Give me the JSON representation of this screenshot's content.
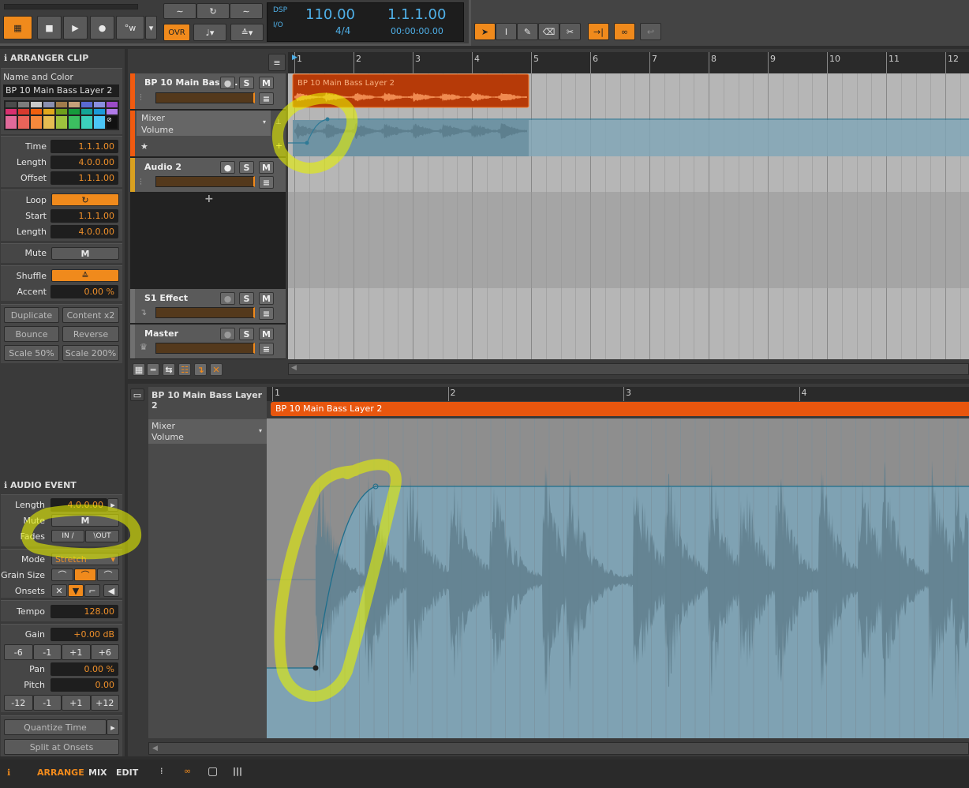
{
  "transport": {
    "ovr": "OVR",
    "dsp": "DSP",
    "io": "I/O",
    "tempo": "110.00",
    "signature": "4/4",
    "position": "1.1.1.00",
    "time": "00:00:00.00",
    "accent": "#f08a1c",
    "display_color": "#4fb0e8"
  },
  "inspector": {
    "clip_title": "ARRANGER CLIP",
    "name_color_label": "Name and Color",
    "clip_name": "BP 10 Main Bass Layer 2",
    "palette": [
      "#4b4b4b",
      "#7d7d7d",
      "#c9c9c9",
      "#8a8fb0",
      "#a17c4c",
      "#c6a07a",
      "#5a6ad1",
      "#8a8fe0",
      "#9b4bc7",
      "#d8306f",
      "#d63a2e",
      "#f0600e",
      "#e0a81c",
      "#6e9f1c",
      "#169a3c",
      "#13a596",
      "#1a9ad8",
      "#b07ae8",
      "#e06a9a",
      "#e8645a",
      "#f6893c",
      "#e6bd52",
      "#9ec23e",
      "#3cbf60",
      "#3ccfbb",
      "#4cc6f6"
    ],
    "time_label": "Time",
    "time": "1.1.1.00",
    "length_label": "Length",
    "length": "4.0.0.00",
    "offset_label": "Offset",
    "offset": "1.1.1.00",
    "loop_label": "Loop",
    "start_label": "Start",
    "start": "1.1.1.00",
    "loop_length_label": "Length",
    "loop_length": "4.0.0.00",
    "mute_label": "Mute",
    "mute": "M",
    "shuffle_label": "Shuffle",
    "accent_label": "Accent",
    "accent": "0.00 %",
    "actions": [
      "Duplicate",
      "Content x2",
      "Bounce",
      "Reverse",
      "Scale 50%",
      "Scale 200%"
    ],
    "event_title": "AUDIO EVENT",
    "ev_length_label": "Length",
    "ev_length": "4.0.0.00",
    "ev_mute_label": "Mute",
    "ev_mute": "M",
    "fades_label": "Fades",
    "fade_in": "IN",
    "fade_out": "OUT",
    "mode_label": "Mode",
    "mode": "Stretch",
    "grain_label": "Grain Size",
    "onsets_label": "Onsets",
    "tempo_label": "Tempo",
    "tempo": "128.00",
    "gain_label": "Gain",
    "gain": "+0.00 dB",
    "gain_steps": [
      "-6",
      "-1",
      "+1",
      "+6"
    ],
    "pan_label": "Pan",
    "pan": "0.00 %",
    "pitch_label": "Pitch",
    "pitch": "0.00",
    "pitch_steps": [
      "-12",
      "-1",
      "+1",
      "+12"
    ],
    "quantize": "Quantize Time",
    "split": "Split at Onsets"
  },
  "arranger": {
    "bars": [
      "1",
      "2",
      "3",
      "4",
      "5",
      "6",
      "7",
      "8",
      "9",
      "10",
      "11",
      "12"
    ],
    "tracks": [
      {
        "name": "BP 10 Main Bass ...",
        "color": "#f05a10"
      },
      {
        "name": "Audio 2",
        "color": "#d8a020"
      },
      {
        "name": "S1 Effect",
        "color": "#707070"
      },
      {
        "name": "Master",
        "color": "#707070"
      }
    ],
    "automation": {
      "device": "Mixer",
      "param": "Volume"
    },
    "clip_name": "BP 10 Main Bass Layer 2",
    "solo": "S",
    "mute": "M",
    "add": "+"
  },
  "editor": {
    "title": "BP 10 Main Bass Layer 2",
    "bars": [
      "1",
      "2",
      "3",
      "4"
    ],
    "clip_name": "BP 10 Main Bass Layer 2",
    "device": "Mixer",
    "param": "Volume"
  },
  "bottom": {
    "arrange": "ARRANGE",
    "mix": "MIX",
    "edit": "EDIT"
  }
}
